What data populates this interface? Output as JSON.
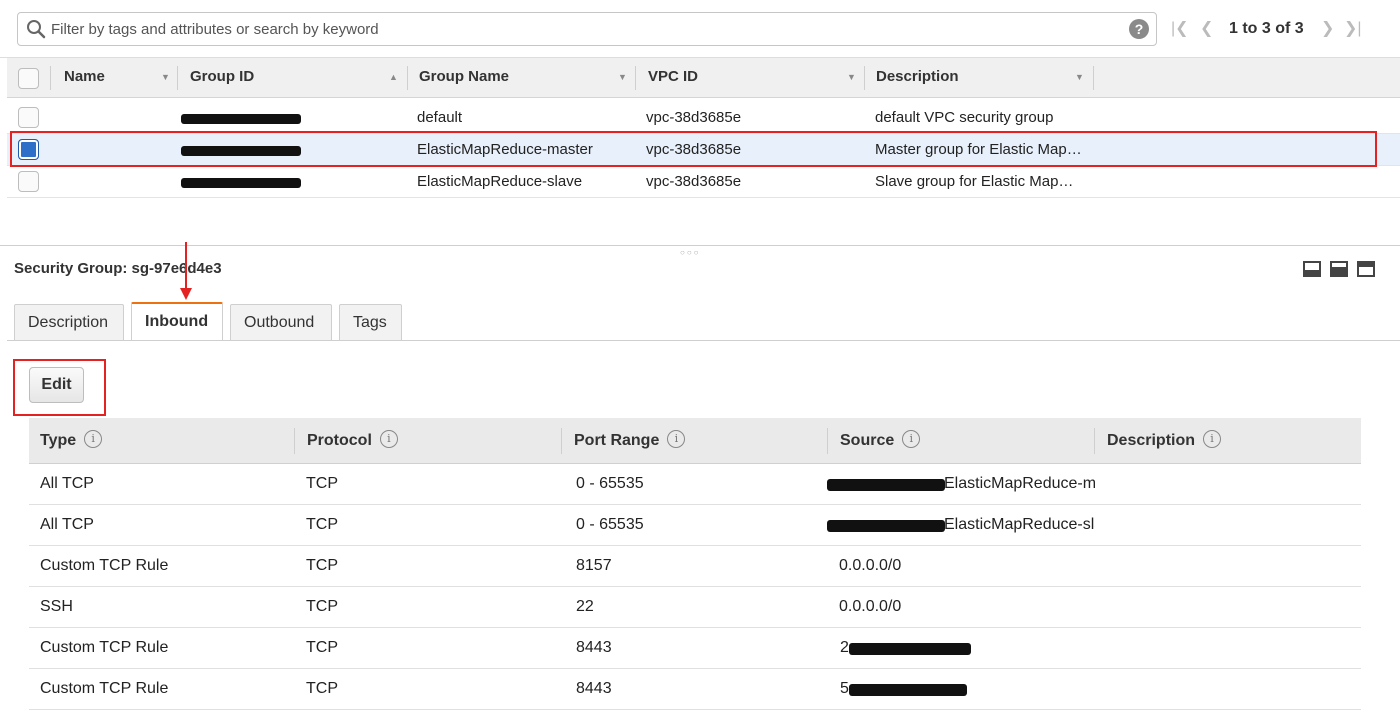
{
  "search": {
    "placeholder": "Filter by tags and attributes or search by keyword",
    "help": "?",
    "pager": "1 to 3 of 3"
  },
  "groups_table": {
    "columns": [
      "Name",
      "Group ID",
      "Group Name",
      "VPC ID",
      "Description"
    ],
    "rows": [
      {
        "name": "",
        "group_name": "default",
        "vpc_id": "vpc-38d3685e",
        "description": "default VPC security group",
        "selected": false
      },
      {
        "name": "",
        "group_name": "ElasticMapReduce-master",
        "vpc_id": "vpc-38d3685e",
        "description": "Master group for Elastic Map…",
        "selected": true
      },
      {
        "name": "",
        "group_name": "ElasticMapReduce-slave",
        "vpc_id": "vpc-38d3685e",
        "description": "Slave group for Elastic Map…",
        "selected": false
      }
    ]
  },
  "detail": {
    "title": "Security Group: sg-97e6d4e3",
    "tabs": [
      "Description",
      "Inbound",
      "Outbound",
      "Tags"
    ],
    "active_tab": "Inbound",
    "edit_label": "Edit"
  },
  "rules_table": {
    "columns": [
      "Type",
      "Protocol",
      "Port Range",
      "Source",
      "Description"
    ],
    "info_glyph": "i",
    "rows": [
      {
        "type": "All TCP",
        "protocol": "TCP",
        "port": "0 - 65535",
        "source": "ElasticMapReduce-m"
      },
      {
        "type": "All TCP",
        "protocol": "TCP",
        "port": "0 - 65535",
        "source": "ElasticMapReduce-sla"
      },
      {
        "type": "Custom TCP Rule",
        "protocol": "TCP",
        "port": "8157",
        "source": "0.0.0.0/0"
      },
      {
        "type": "SSH",
        "protocol": "TCP",
        "port": "22",
        "source": "0.0.0.0/0"
      },
      {
        "type": "Custom TCP Rule",
        "protocol": "TCP",
        "port": "8443",
        "source": "2"
      },
      {
        "type": "Custom TCP Rule",
        "protocol": "TCP",
        "port": "8443",
        "source": "5"
      }
    ]
  },
  "colors": {
    "highlight": "#e52222",
    "accent_tab": "#ec7211",
    "checkbox_checked": "#2e6fc8"
  }
}
